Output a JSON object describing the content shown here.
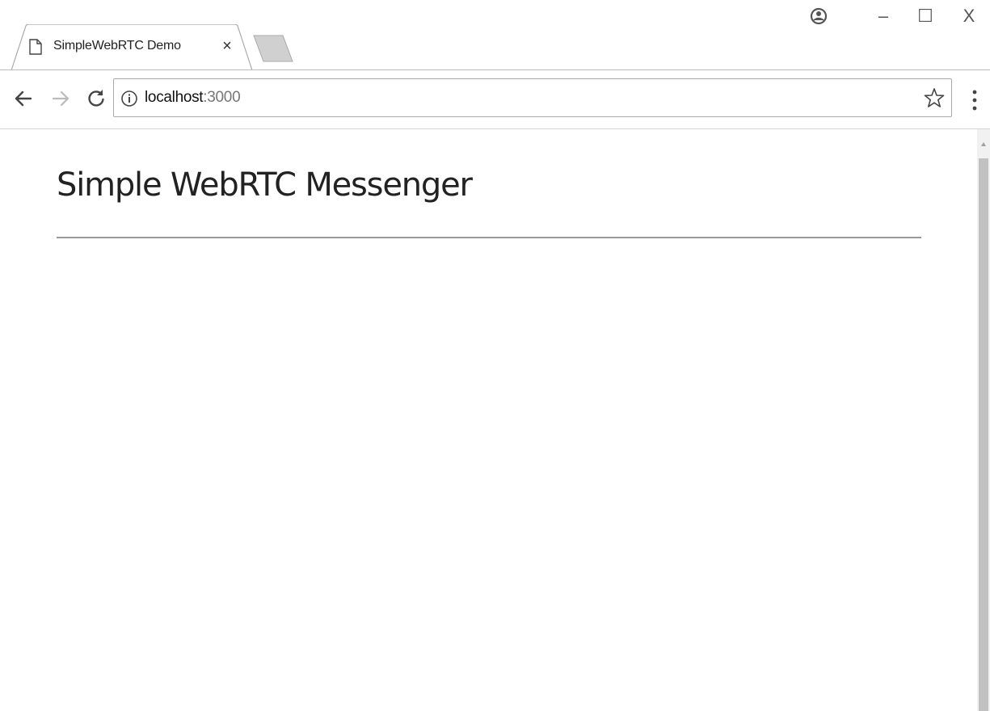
{
  "window": {
    "tab_title": "SimpleWebRTC Demo",
    "tab_close_glyph": "×",
    "controls": {
      "minimize_glyph": "–",
      "maximize_glyph": "☐",
      "close_glyph": "X"
    }
  },
  "toolbar": {
    "url_host": "localhost",
    "url_port": ":3000"
  },
  "page": {
    "heading": "Simple WebRTC Messenger"
  },
  "icons": {
    "tab": "page-icon",
    "new_tab": "new-tab-icon",
    "profile": "profile-icon",
    "back": "back-arrow-icon",
    "forward": "forward-arrow-icon",
    "reload": "reload-icon",
    "site_info": "info-icon",
    "bookmark": "star-icon",
    "menu": "kebab-menu-icon"
  },
  "colors": {
    "chrome_border": "#a9a9a9",
    "text": "#222222",
    "url_port": "#777777",
    "rule": "#999999",
    "scroll_thumb": "#c1c1c1"
  }
}
